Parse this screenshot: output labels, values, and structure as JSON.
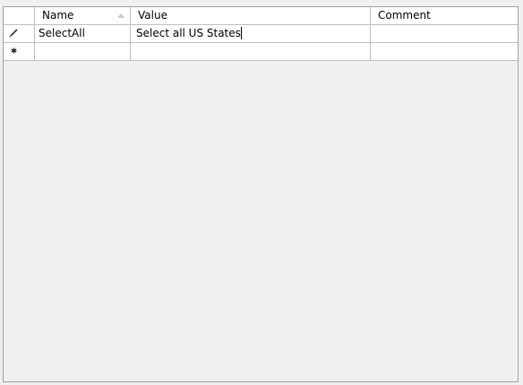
{
  "columns": {
    "name": "Name",
    "value": "Value",
    "comment": "Comment"
  },
  "header": {
    "sort_column": "name",
    "sort_direction": "ascending"
  },
  "rows": [
    {
      "indicator": "pencil-icon",
      "name": "SelectAll",
      "value": "Select all US States",
      "comment": ""
    },
    {
      "indicator": "asterisk-icon",
      "name": "",
      "value": "",
      "comment": ""
    }
  ],
  "colors": {
    "background": "#f0f0f0",
    "grid_line": "#bfbfbf",
    "cell_background": "#ffffff"
  }
}
